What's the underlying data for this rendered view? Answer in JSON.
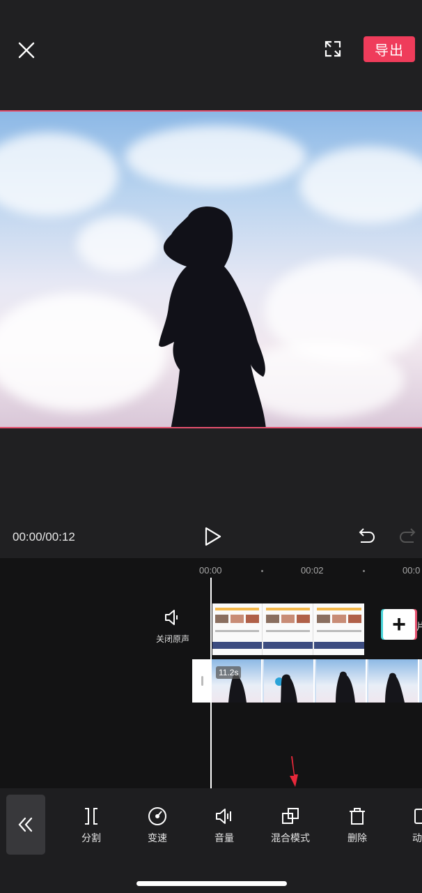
{
  "header": {
    "export_label": "导出"
  },
  "player": {
    "time": "00:00/00:12"
  },
  "timeline": {
    "ruler": [
      "00:00",
      "00:02",
      "00:0"
    ],
    "mute_label": "关闭原声",
    "clip_duration": "11.2s",
    "add_clip_side_text": "片"
  },
  "toolbar": {
    "tools": [
      {
        "label": "分割",
        "icon": "split-icon"
      },
      {
        "label": "变速",
        "icon": "speed-icon"
      },
      {
        "label": "音量",
        "icon": "volume-icon"
      },
      {
        "label": "混合模式",
        "icon": "blend-mode-icon"
      },
      {
        "label": "删除",
        "icon": "delete-icon"
      },
      {
        "label": "动",
        "icon": "animation-icon"
      }
    ]
  },
  "colors": {
    "accent": "#ef3c5b",
    "background": "#202022",
    "timeline_bg": "#131314",
    "highlight": "#e5506e"
  }
}
